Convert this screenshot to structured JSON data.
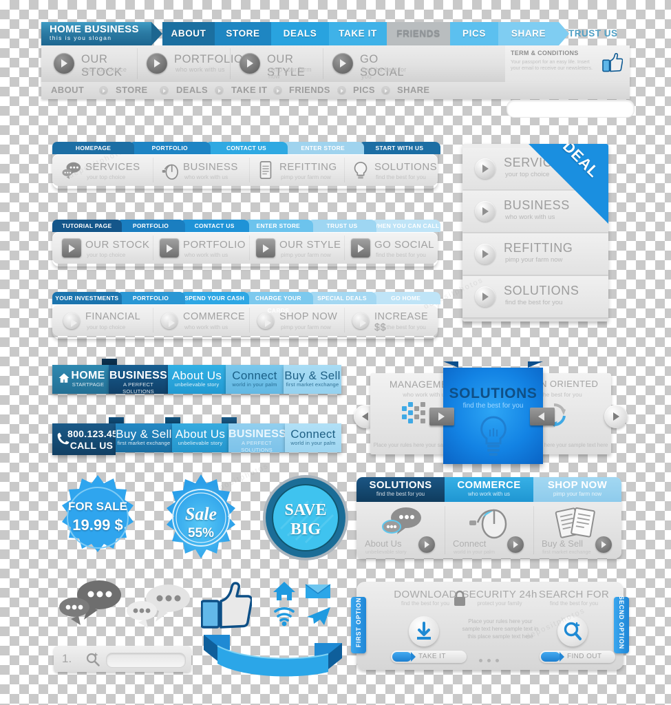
{
  "brand": {
    "title": "HOME BUSINESS",
    "slogan": "this is you slogan"
  },
  "top_header": {
    "arrow_nav": [
      {
        "label": "ABOUT",
        "color": "#1b6fa0"
      },
      {
        "label": "STORE",
        "color": "#1e86c2"
      },
      {
        "label": "DEALS",
        "color": "#29a3df"
      },
      {
        "label": "TAKE IT",
        "color": "#3fb2e8"
      },
      {
        "label": "FRIENDS",
        "color": "#b9bdbf"
      },
      {
        "label": "PICS",
        "color": "#5cc0ef"
      },
      {
        "label": "SHARE",
        "color": "#7fcdf2"
      }
    ],
    "trust_label": "TRUST US",
    "features": [
      {
        "title": "OUR STOCK",
        "subtitle": "your top choice"
      },
      {
        "title": "PORTFOLIO",
        "subtitle": "who work with us"
      },
      {
        "title": "OUR STYLE",
        "subtitle": "pimp your farm now"
      },
      {
        "title": "GO SOCIAL",
        "subtitle": "find the best for you"
      }
    ],
    "terms": {
      "title": "TERM & CONDITIONS",
      "body": "Your passport for an easy life. Insert your email to receive our newsletters.",
      "icon": "thumbs-up-icon",
      "email_placeholder": ""
    },
    "bottom_nav": [
      "ABOUT",
      "STORE",
      "DEALS",
      "TAKE IT",
      "FRIENDS",
      "PICS",
      "SHARE"
    ]
  },
  "nav_block_2": {
    "tabs": [
      {
        "label": "HOMEPAGE",
        "color": "#1c6ea4"
      },
      {
        "label": "PORTFOLIO",
        "color": "#1e84c4"
      },
      {
        "label": "CONTACT US",
        "color": "#2fa9e2"
      },
      {
        "label": "ENTER STORE",
        "color": "#9fd3ee"
      },
      {
        "label": "START WITH US",
        "color": "#1c6ea4"
      }
    ],
    "items": [
      {
        "title": "SERVICES",
        "subtitle": "your top choice",
        "icon": "chat-bubbles-icon"
      },
      {
        "title": "BUSINESS",
        "subtitle": "who work with us",
        "icon": "mouse-icon"
      },
      {
        "title": "REFITTING",
        "subtitle": "pimp your farm now",
        "icon": "document-icon"
      },
      {
        "title": "SOLUTIONS",
        "subtitle": "find the best for you",
        "icon": "lightbulb-icon"
      }
    ]
  },
  "nav_block_3": {
    "tabs": [
      {
        "label": "TUTORIAL PAGE",
        "color": "#14568a"
      },
      {
        "label": "PORTFOLIO",
        "color": "#1a7ec0"
      },
      {
        "label": "CONTACT US",
        "color": "#1f93d7"
      },
      {
        "label": "ENTER STORE",
        "color": "#6cc3ed"
      },
      {
        "label": "TRUST US",
        "color": "#9ed6f2"
      },
      {
        "label": "WHEN YOU CAN CALL",
        "color": "#bfe4f7"
      }
    ],
    "items": [
      {
        "title": "OUR STOCK",
        "subtitle": "your top choice"
      },
      {
        "title": "PORTFOLIO",
        "subtitle": "who work with us"
      },
      {
        "title": "OUR STYLE",
        "subtitle": "pimp your farm now"
      },
      {
        "title": "GO SOCIAL",
        "subtitle": "find the best for you"
      }
    ]
  },
  "nav_block_4": {
    "tabs": [
      {
        "label": "YOUR INVESTMENTS",
        "color": "#1b74ae"
      },
      {
        "label": "PORTFOLIO",
        "color": "#2a97d4"
      },
      {
        "label": "SPEND YOUR CASH",
        "color": "#2ea7e4"
      },
      {
        "label": "CHARGE YOUR CARDS",
        "color": "#7cc9ee"
      },
      {
        "label": "SPECIAL DEALS",
        "color": "#a4d8f2"
      },
      {
        "label": "GO HOME",
        "color": "#bfe4f7"
      }
    ],
    "items": [
      {
        "title": "FINANCIAL",
        "subtitle": "your top choice"
      },
      {
        "title": "COMMERCE",
        "subtitle": "who work with us"
      },
      {
        "title": "SHOP NOW",
        "subtitle": "pimp your farm now"
      },
      {
        "title": "INCREASE $$",
        "subtitle": "find the best for you"
      }
    ]
  },
  "deal_panel": {
    "ribbon": "DEAL",
    "ribbon_color": "#1a8fe0",
    "rows": [
      {
        "title": "SERVICES",
        "subtitle": "your top choice"
      },
      {
        "title": "BUSINESS",
        "subtitle": "who work with us"
      },
      {
        "title": "REFITTING",
        "subtitle": "pimp your farm now"
      },
      {
        "title": "SOLUTIONS",
        "subtitle": "find the best for you"
      }
    ]
  },
  "ribbon_row_1": [
    {
      "title": "HOME",
      "subtitle": "STARTPAGE",
      "color": "#2a7ea6",
      "icon": "home-icon"
    },
    {
      "title": "BUSINESS",
      "subtitle": "A PERFECT SOLUTIONS",
      "color": "#14568a"
    },
    {
      "title": "About Us",
      "subtitle": "unbelievable story",
      "color": "#29a8de"
    },
    {
      "title": "Connect",
      "subtitle": "world in your palm",
      "color": "#6dc1e8"
    },
    {
      "title": "Buy & Sell",
      "subtitle": "first market exchange",
      "color": "#9fd5f0"
    }
  ],
  "ribbon_row_2": [
    {
      "title": "800.123.456",
      "subtitle": "CALL US",
      "color": "#16486f",
      "icon": "phone-icon"
    },
    {
      "title": "Buy & Sell",
      "subtitle": "first market exchange",
      "color": "#1d7fba"
    },
    {
      "title": "About Us",
      "subtitle": "unbelievable story",
      "color": "#2ba0d8"
    },
    {
      "title": "BUSINESS",
      "subtitle": "A PERFECT SOLUTIONS",
      "color": "#84c9ec"
    },
    {
      "title": "Connect",
      "subtitle": "world in your palm",
      "color": "#a9dbf4"
    }
  ],
  "carousel": {
    "left_card": {
      "title": "MANAGEMENT",
      "subtitle": "who work with us",
      "body": "Place your rules here your sample text here",
      "icon": "dots-matrix-icon"
    },
    "center_card": {
      "title": "SOLUTIONS",
      "subtitle": "find the best for you",
      "icon": "lightbulb-icon"
    },
    "right_card": {
      "title": "GREEN ORIENTED",
      "subtitle": "find the best for you",
      "body": "Place your rules here your sample text here",
      "icon": "recycle-icon"
    },
    "prev_label": "prev-arrow",
    "next_label": "next-arrow"
  },
  "badges": [
    {
      "name": "for-sale-badge",
      "line1": "FOR SALE",
      "line2": "19.99 $",
      "color": "#2fa5ee"
    },
    {
      "name": "sale-badge",
      "line1": "Sale",
      "line2": "55%",
      "color": "#33aef0"
    },
    {
      "name": "save-big-badge",
      "line1": "SAVE",
      "line2": "BIG",
      "color": "#1b7fb5"
    }
  ],
  "cards3": {
    "headers": [
      {
        "title": "SOLUTIONS",
        "subtitle": "find the best for you",
        "color": "#14456e"
      },
      {
        "title": "COMMERCE",
        "subtitle": "who work with us",
        "color": "#2ca3dd"
      },
      {
        "title": "SHOP NOW",
        "subtitle": "pimp your farm now",
        "color": "#97d1ee"
      }
    ],
    "items": [
      {
        "label": "About Us",
        "sublabel": "unbelievable story",
        "icon": "chat-bubbles-icon"
      },
      {
        "label": "Connect",
        "sublabel": "world in your palm",
        "icon": "mouse-icon"
      },
      {
        "label": "Buy & Sell",
        "sublabel": "first market exchange",
        "icon": "documents-icon"
      }
    ]
  },
  "bottom_panel": {
    "left_tab": "FIRST OPTION",
    "right_tab": "SECND OPTION",
    "columns": [
      {
        "title": "DOWNLOAD",
        "subtitle": "find the best for you",
        "icon": "download-icon",
        "button": "TAKE IT"
      },
      {
        "title": "SECURITY 24h",
        "subtitle": "protect your family",
        "icon": "lock-icon",
        "body": "Place your rules here your sample text here sample text in this place sample text here"
      },
      {
        "title": "SEARCH FOR",
        "subtitle": "find the best for you",
        "icon": "search-icon",
        "button": "FIND OUT"
      }
    ],
    "pager_dots": 3
  },
  "icon_row": {
    "icons": [
      {
        "name": "chat-bubbles-dark-icon"
      },
      {
        "name": "chat-bubbles-light-icon"
      },
      {
        "name": "thumbs-up-icon"
      },
      {
        "name": "home-icon"
      },
      {
        "name": "mail-icon"
      },
      {
        "name": "wifi-icon"
      },
      {
        "name": "airplane-icon"
      }
    ],
    "ribbon_banner": "blue-wave-ribbon"
  },
  "search_bar": {
    "number": "1.",
    "icon": "search-icon",
    "value": "",
    "placeholder": ""
  },
  "watermarks": [
    "depositphotos",
    "depositphotos",
    "depositphotos",
    "depositphotos"
  ]
}
